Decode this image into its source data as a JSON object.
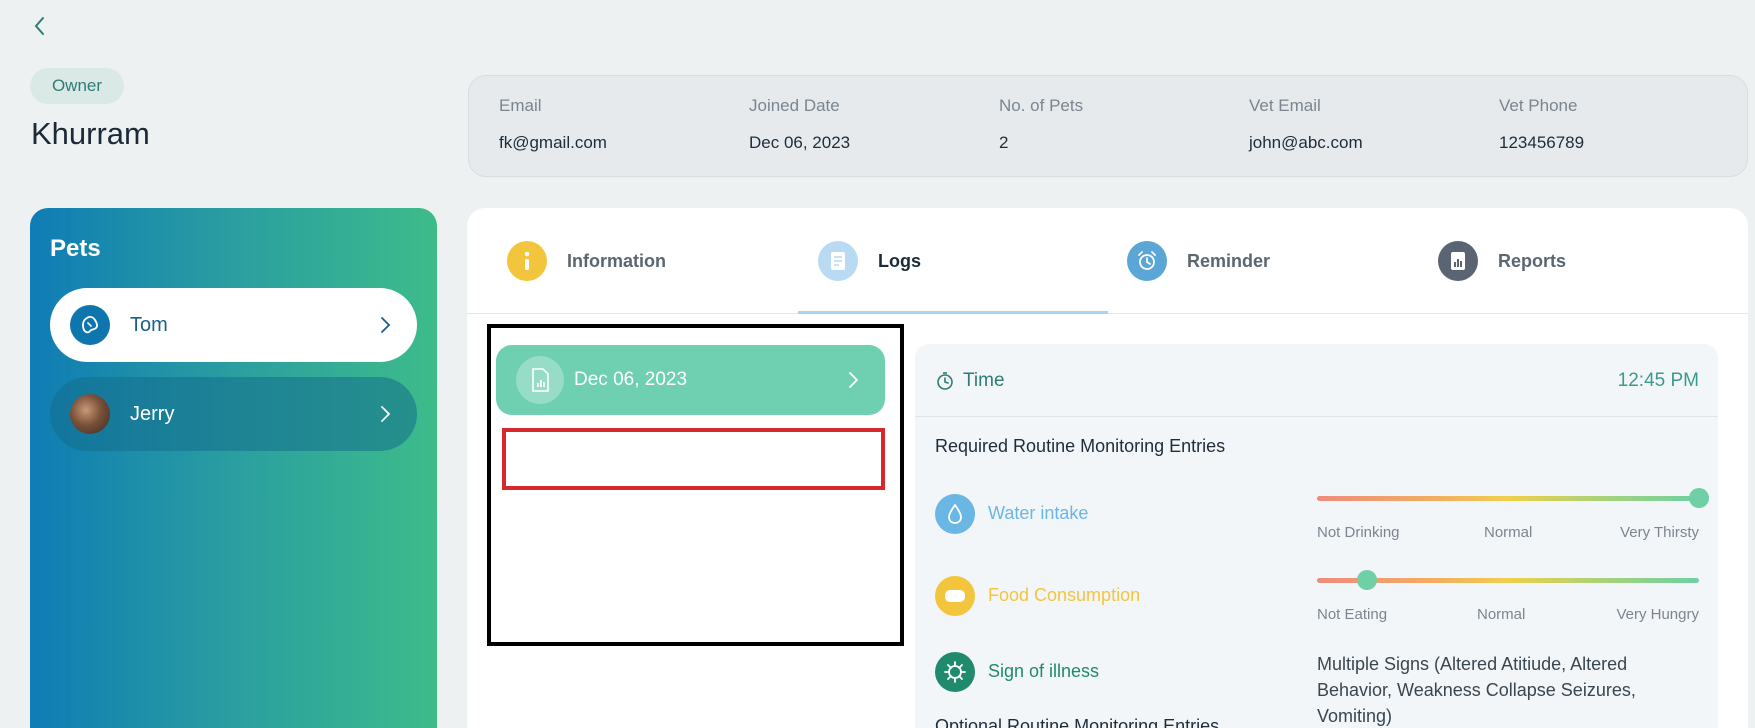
{
  "owner": {
    "badge": "Owner",
    "name": "Khurram"
  },
  "info": {
    "email_label": "Email",
    "email": "fk@gmail.com",
    "joined_label": "Joined Date",
    "joined": "Dec 06, 2023",
    "pets_label": "No. of Pets",
    "pets": "2",
    "vet_email_label": "Vet Email",
    "vet_email": "john@abc.com",
    "vet_phone_label": "Vet Phone",
    "vet_phone": "123456789"
  },
  "pets": {
    "title": "Pets",
    "items": [
      {
        "name": "Tom",
        "selected": true
      },
      {
        "name": "Jerry",
        "selected": false
      }
    ]
  },
  "tabs": [
    {
      "label": "Information",
      "icon": "info-icon",
      "color": "#f3c53c"
    },
    {
      "label": "Logs",
      "icon": "document-icon",
      "color": "#b8daf2",
      "active": true
    },
    {
      "label": "Reminder",
      "icon": "alarm-clock-icon",
      "color": "#5aa6d6"
    },
    {
      "label": "Reports",
      "icon": "report-icon",
      "color": "#5b6473"
    }
  ],
  "logs": {
    "dates": [
      "Dec 06, 2023"
    ]
  },
  "detail": {
    "time_label": "Time",
    "time_value": "12:45 PM",
    "required_title": "Required Routine Monitoring Entries",
    "water": {
      "label": "Water intake",
      "color": "#6ab7e6",
      "level": 1.0,
      "scale": [
        "Not Drinking",
        "Normal",
        "Very Thirsty"
      ]
    },
    "food": {
      "label": "Food Consumption",
      "color": "#f3c53c",
      "level": 0.13,
      "scale": [
        "Not Eating",
        "Normal",
        "Very Hungry"
      ]
    },
    "illness": {
      "label": "Sign of illness",
      "color": "#1f8a6e",
      "value": "Multiple Signs (Altered Atitiude, Altered Behavior, Weakness Collapse Seizures, Vomiting)"
    },
    "optional_title": "Optional Routine Monitoring Entries"
  }
}
